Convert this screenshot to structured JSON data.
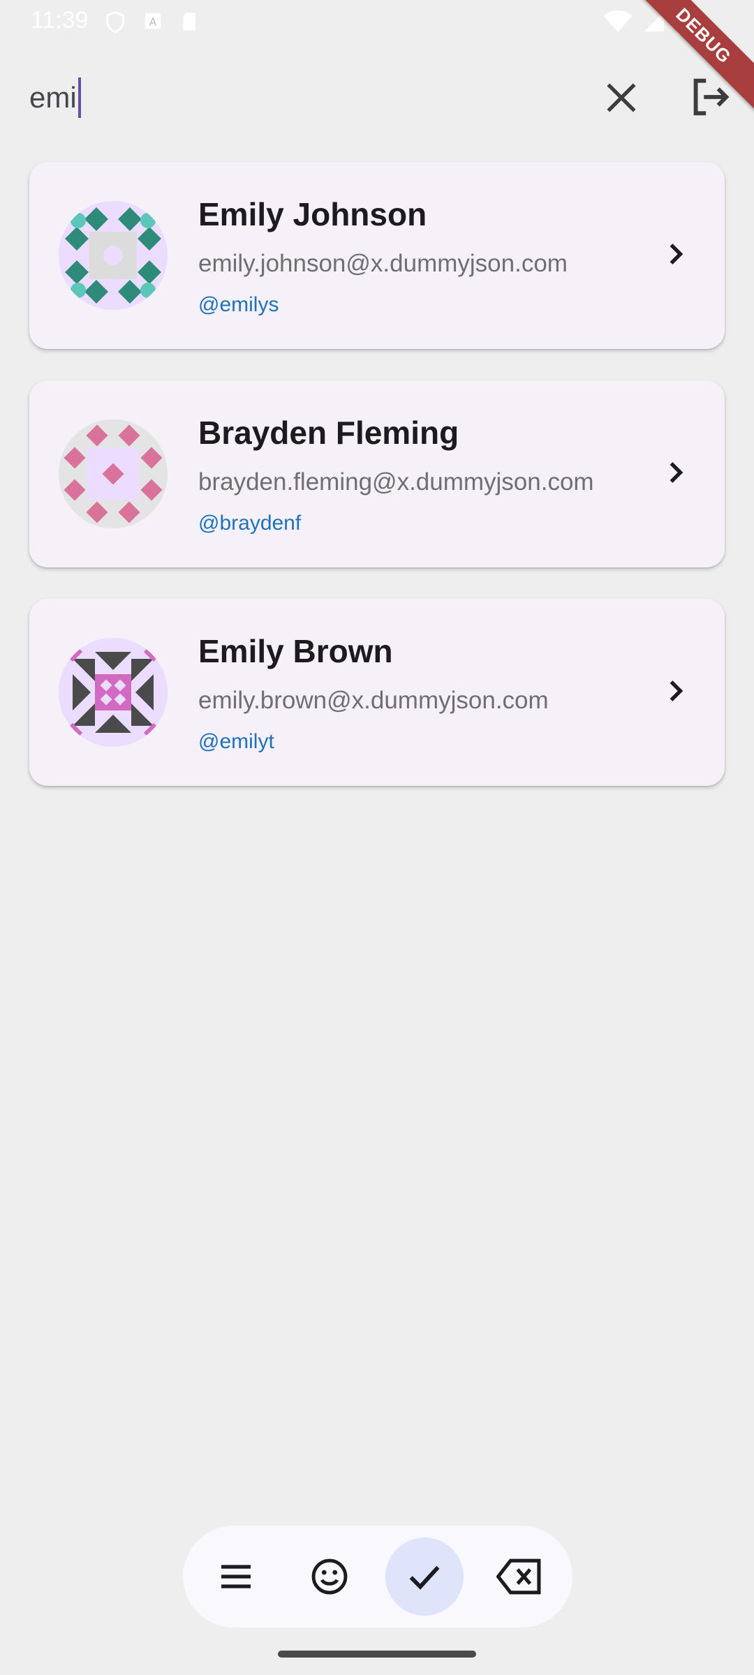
{
  "status_bar": {
    "time": "11:39"
  },
  "debug_banner": "DEBUG",
  "search": {
    "value": "emi"
  },
  "users": [
    {
      "name": "Emily Johnson",
      "email": "emily.johnson@x.dummyjson.com",
      "handle": "@emilys",
      "avatar_colors": [
        "#2e8b7a",
        "#5cc7b8"
      ]
    },
    {
      "name": "Brayden Fleming",
      "email": "brayden.fleming@x.dummyjson.com",
      "handle": "@braydenf",
      "avatar_colors": [
        "#d9739b"
      ]
    },
    {
      "name": "Emily Brown",
      "email": "emily.brown@x.dummyjson.com",
      "handle": "@emilyt",
      "avatar_colors": [
        "#d36ac2",
        "#4a4a4a"
      ]
    }
  ],
  "keyboard_toolbar": {
    "buttons": [
      "menu-icon",
      "emoji-icon",
      "check-icon",
      "backspace-icon"
    ]
  },
  "colors": {
    "background": "#eeeeee",
    "card": "#f6f1f8",
    "accent": "#6750a4",
    "handle": "#1e72bb"
  }
}
